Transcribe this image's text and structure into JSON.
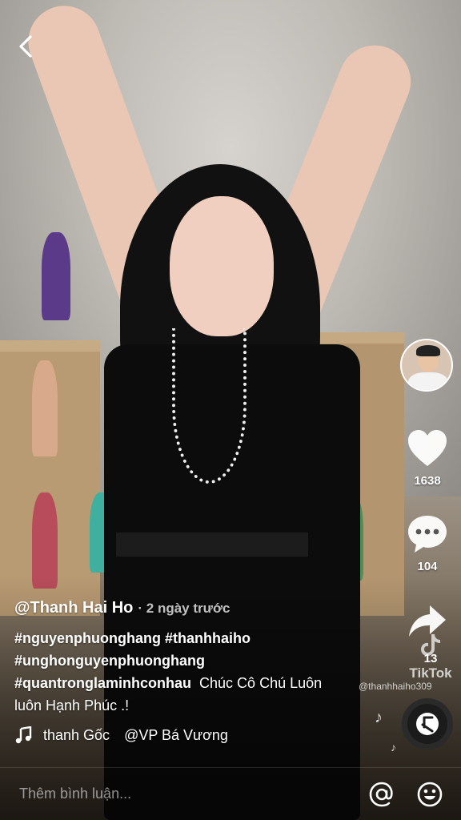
{
  "post": {
    "author": "@Thanh Hai Ho",
    "time": "· 2 ngày trước",
    "hashtags": [
      "#nguyenphuonghang",
      "#thanhhaiho",
      "#unghonguyenphuonghang",
      "#quantronglaminhconhau"
    ],
    "message_part1": "Chúc Cô Chú Luôn",
    "message_part2": "luôn Hạnh Phúc .!"
  },
  "actions": {
    "like_count": "1638",
    "comment_count": "104",
    "share_count": "13"
  },
  "music": {
    "label": "thanh Gốc",
    "artist": "@VP Bá Vương"
  },
  "watermark": {
    "brand": "TikTok",
    "user": "@thanhhaiho309"
  },
  "comment_bar": {
    "placeholder": "Thêm bình luận..."
  },
  "icons": {
    "back": "chevron-left-icon",
    "like": "heart-icon",
    "comment": "comment-bubble-icon",
    "share": "share-arrow-icon",
    "music": "music-note-icon",
    "mention": "at-sign-icon",
    "emoji": "smiley-icon"
  },
  "colors": {
    "text": "#ffffff",
    "muted": "#bfbfbf"
  }
}
